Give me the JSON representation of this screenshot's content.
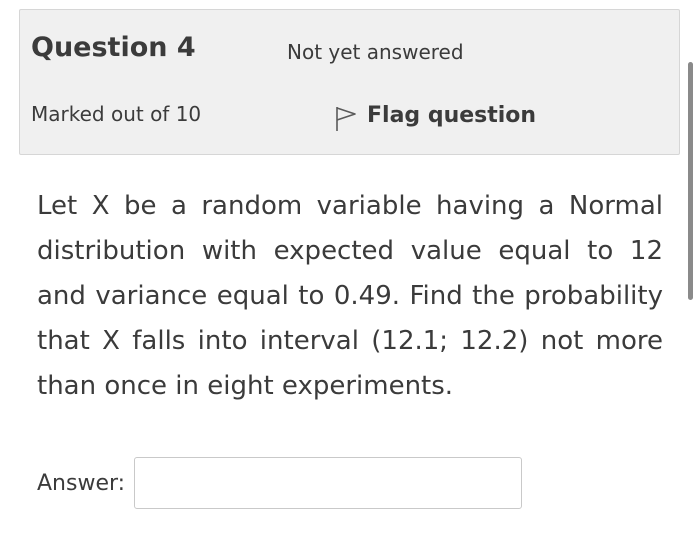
{
  "question": {
    "label": "Question",
    "number": "4",
    "state": "Not yet answered",
    "grade": "Marked out of 10",
    "flag_label": "Flag question",
    "flag_icon": "flag-outline-icon"
  },
  "content": {
    "text": "Let X be a random variable having a Normal distribution with expected value equal to 12 and variance equal to 0.49. Find the probability that X falls into interval (12.1; 12.2) not more than once in eight experiments."
  },
  "answer": {
    "label": "Answer:",
    "value": "",
    "placeholder": ""
  }
}
